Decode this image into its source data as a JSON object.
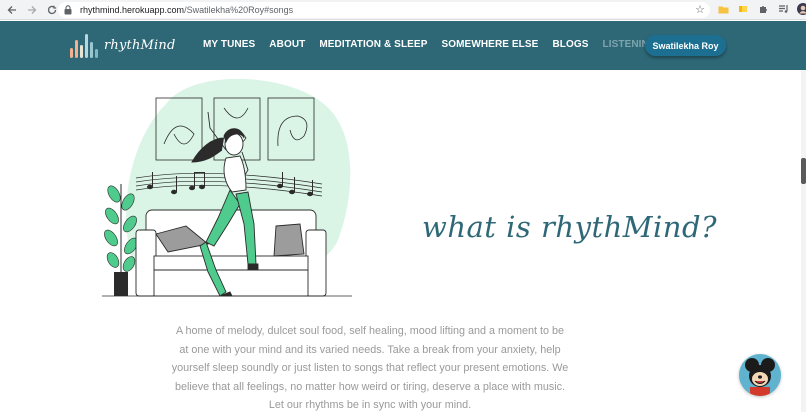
{
  "browser": {
    "url_host": "rhythmind.herokuapp.com",
    "url_path": "/Swatilekha%20Roy#songs"
  },
  "site": {
    "logo_text": "rhythMind",
    "nav": [
      {
        "label": "MY TUNES"
      },
      {
        "label": "ABOUT"
      },
      {
        "label": "MEDITATION & SLEEP"
      },
      {
        "label": "SOMEWHERE ELSE"
      },
      {
        "label": "BLOGS"
      },
      {
        "label": "LISTENING ROOM"
      }
    ],
    "user_name": "Swatilekha Roy"
  },
  "hero": {
    "title": "what is rhythMind?"
  },
  "description": "A home of melody, dulcet soul food, self healing, mood lifting and a moment to be at one with your mind and its varied needs. Take a break from your anxiety, help yourself sleep soundly or just listen to songs that reflect your present emotions. We believe that all feelings, no matter how weird or tiring, deserve a place with music. Let our rhythms be in sync with your mind.",
  "colors": {
    "header_bg": "#2e6877",
    "accent_green": "#3ecf8e",
    "blob": "#daf4e6",
    "title": "#2e6877"
  }
}
